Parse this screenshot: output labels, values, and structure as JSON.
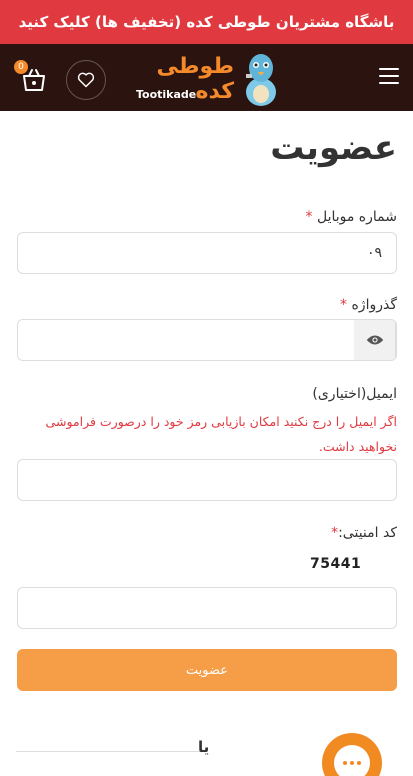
{
  "promo": {
    "text": "باشگاه مشتریان طوطی کده (تخفیف ها) کلیک کنید"
  },
  "header": {
    "logo_fa": "طوطی کده",
    "logo_en": "Tootikade",
    "cart_count": "0",
    "brand_color": "#f48a2a",
    "icons": [
      "menu-icon",
      "heart-icon",
      "cart-icon"
    ]
  },
  "form": {
    "title": "عضویت",
    "mobile_label": "شماره موبایل",
    "mobile_value": "۰۹",
    "password_label": "گذرواژه",
    "password_value": "",
    "email_label": "ایمیل(اختیاری)",
    "email_hint": "اگر ایمیل را درج نکنید امکان بازیابی رمز خود را درصورت فراموشی نخواهید داشت.",
    "email_value": "",
    "captcha_label": "کد امنیتی:",
    "captcha_code": "75441",
    "captcha_value": "",
    "required_mark": "*",
    "submit_label": "عضویت",
    "submit_color": "#f59d47"
  },
  "divider": {
    "text": "یا"
  }
}
